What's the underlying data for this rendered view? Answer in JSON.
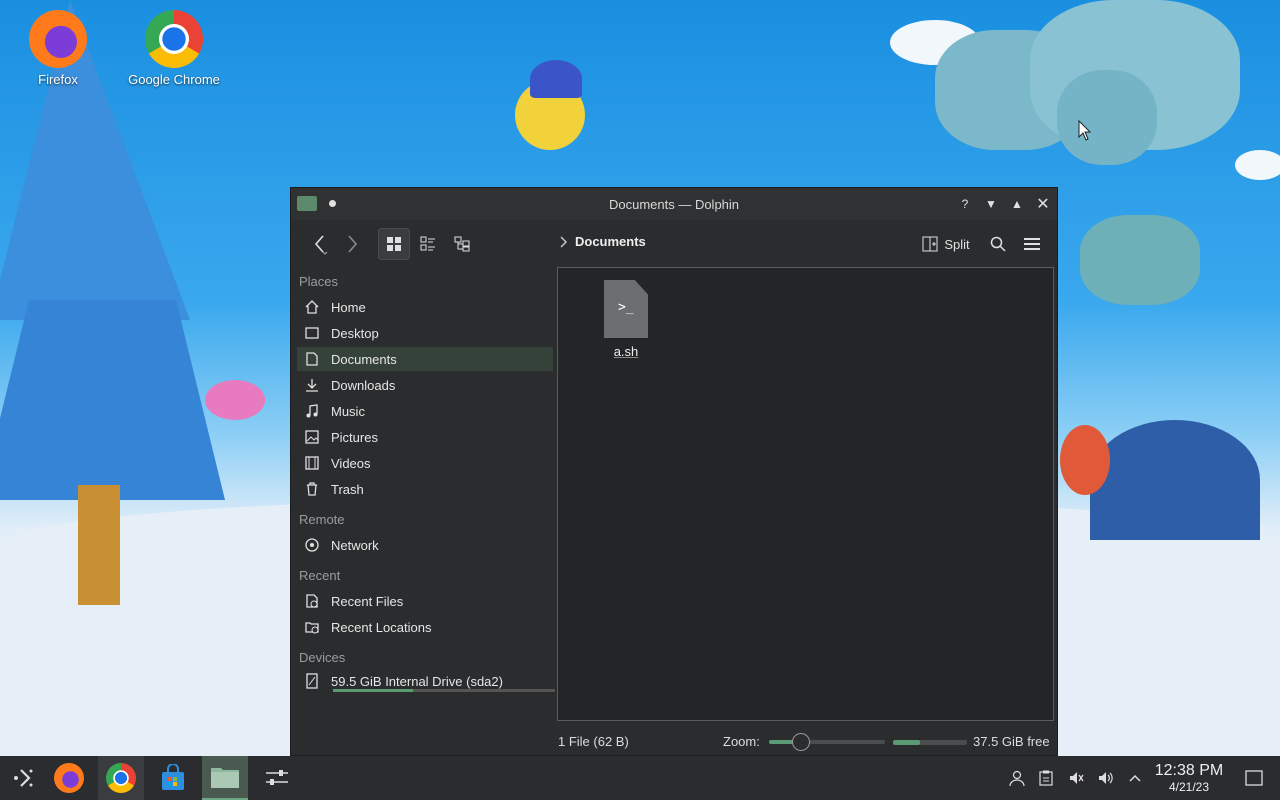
{
  "desktop": {
    "icons": [
      {
        "label": "Firefox"
      },
      {
        "label": "Google Chrome"
      }
    ]
  },
  "window": {
    "title": "Documents — Dolphin",
    "titlebar_buttons": [
      "help-icon",
      "minimize-icon",
      "maximize-icon",
      "close-icon"
    ]
  },
  "toolbar": {
    "breadcrumb": "Documents",
    "split_label": "Split"
  },
  "sidebar": {
    "places_header": "Places",
    "places": [
      {
        "label": "Home",
        "icon": "home-icon"
      },
      {
        "label": "Desktop",
        "icon": "desktop-icon"
      },
      {
        "label": "Documents",
        "icon": "documents-icon",
        "active": true
      },
      {
        "label": "Downloads",
        "icon": "downloads-icon"
      },
      {
        "label": "Music",
        "icon": "music-icon"
      },
      {
        "label": "Pictures",
        "icon": "pictures-icon"
      },
      {
        "label": "Videos",
        "icon": "videos-icon"
      },
      {
        "label": "Trash",
        "icon": "trash-icon"
      }
    ],
    "remote_header": "Remote",
    "remote": [
      {
        "label": "Network",
        "icon": "network-icon"
      }
    ],
    "recent_header": "Recent",
    "recent": [
      {
        "label": "Recent Files",
        "icon": "recent-files-icon"
      },
      {
        "label": "Recent Locations",
        "icon": "recent-locations-icon"
      }
    ],
    "devices_header": "Devices",
    "devices": [
      {
        "label": "59.5 GiB Internal Drive (sda2)",
        "icon": "drive-icon",
        "used_fraction": 0.36
      }
    ]
  },
  "content": {
    "files": [
      {
        "name": "a.sh",
        "icon": "shell-script-icon",
        "glyph": ">_"
      }
    ]
  },
  "status": {
    "summary": "1 File (62 B)",
    "zoom_label": "Zoom:",
    "zoom_fraction": 0.28,
    "free_label": "37.5 GiB free",
    "free_used_fraction": 0.36
  },
  "taskbar": {
    "time": "12:38 PM",
    "date": "4/21/23"
  },
  "colors": {
    "accent": "#5c9a74",
    "window_bg": "#2a2c2e",
    "taskbar_bg": "#2a2c2f"
  }
}
